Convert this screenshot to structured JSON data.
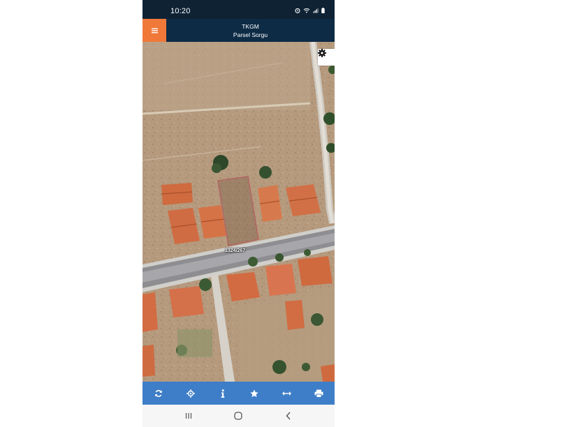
{
  "status_bar": {
    "time": "10:20",
    "icons": [
      "alarm-icon",
      "wifi-icon",
      "signal-icon",
      "battery-icon"
    ]
  },
  "header": {
    "title": "TKGM",
    "subtitle": "Parsel Sorgu",
    "menu_icon": "hamburger-menu-icon",
    "accent_color": "#f0793a",
    "background_color": "#0d2b45"
  },
  "map": {
    "type": "satellite",
    "parcel_label": "1324/267",
    "parcel_outline_color": "#b0193a",
    "settings_icon": "gear-icon"
  },
  "toolbar": {
    "background_color": "#3e7ec8",
    "buttons": [
      {
        "icon": "refresh-icon"
      },
      {
        "icon": "locate-icon"
      },
      {
        "icon": "info-icon"
      },
      {
        "icon": "star-icon"
      },
      {
        "icon": "measure-icon"
      },
      {
        "icon": "print-icon"
      }
    ]
  },
  "nav_bar": {
    "buttons": [
      "recent-apps-icon",
      "home-icon",
      "back-icon"
    ]
  }
}
